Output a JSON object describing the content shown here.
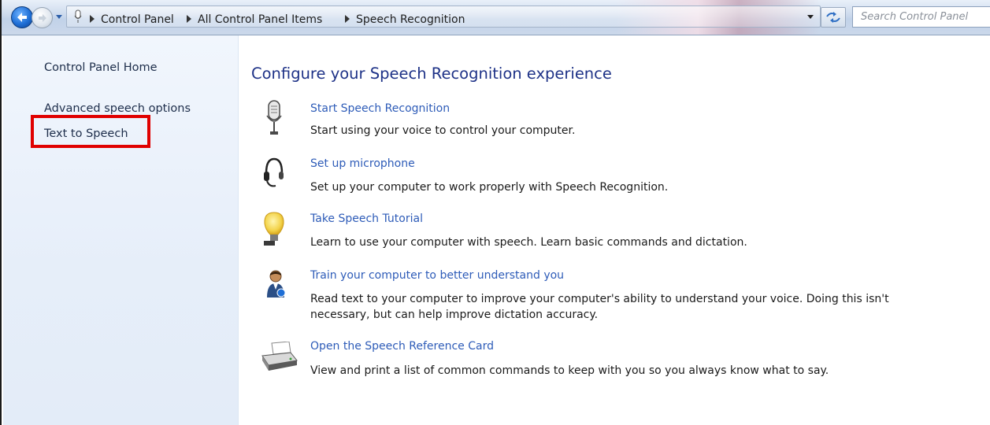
{
  "address_bar": {
    "breadcrumbs": [
      "Control Panel",
      "All Control Panel Items",
      "Speech Recognition"
    ],
    "search_placeholder": "Search Control Panel"
  },
  "left_pane": {
    "links": [
      "Control Panel Home",
      "Advanced speech options",
      "Text to Speech"
    ],
    "highlighted": "Text to Speech",
    "highlight_color": "#e00000"
  },
  "main": {
    "heading": "Configure your Speech Recognition experience",
    "tasks": [
      {
        "icon": "microphone-icon",
        "title": "Start Speech Recognition",
        "description": "Start using your voice to control your computer."
      },
      {
        "icon": "headset-icon",
        "title": "Set up microphone",
        "description": "Set up your computer to work properly with Speech Recognition."
      },
      {
        "icon": "lightbulb-icon",
        "title": "Take Speech Tutorial",
        "description": "Learn to use your computer with speech.  Learn basic commands and dictation."
      },
      {
        "icon": "person-icon",
        "title": "Train your computer to better understand you",
        "description": "Read text to your computer to improve your computer's ability to understand your voice.  Doing this isn't necessary, but can help improve dictation accuracy."
      },
      {
        "icon": "printer-icon",
        "title": "Open the Speech Reference Card",
        "description": "View and print a list of common commands to keep with you so you always know what to say."
      }
    ]
  },
  "colors": {
    "link": "#2e5cb8",
    "heading": "#1e3287",
    "left_pane_bg": "#e6eef9"
  }
}
